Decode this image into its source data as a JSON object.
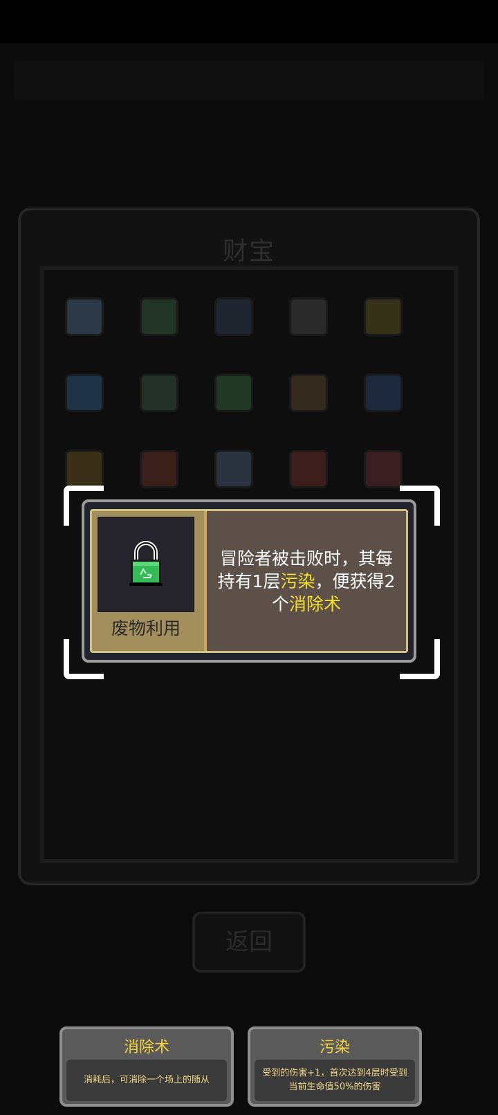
{
  "panel": {
    "title": "财宝"
  },
  "items": [
    {
      "icon": "bag-icon",
      "color": "#2b3846",
      "row": 0,
      "col": 0
    },
    {
      "icon": "leaf-pile-icon",
      "color": "#213426",
      "row": 0,
      "col": 1
    },
    {
      "icon": "shield-icon",
      "color": "#1f2630",
      "row": 0,
      "col": 2
    },
    {
      "icon": "chest-icon",
      "color": "#2a2a2a",
      "row": 0,
      "col": 3
    },
    {
      "icon": "amulet-icon",
      "color": "#36321a",
      "row": 0,
      "col": 4
    },
    {
      "icon": "water-drop-icon",
      "color": "#1f3347",
      "row": 1,
      "col": 0
    },
    {
      "icon": "plant-icon",
      "color": "#223028",
      "row": 1,
      "col": 1
    },
    {
      "icon": "recycle-lock-icon",
      "color": "#223826",
      "row": 1,
      "col": 2
    },
    {
      "icon": "rune-icon",
      "color": "#33291c",
      "row": 1,
      "col": 3
    },
    {
      "icon": "potion-jar-icon",
      "color": "#1d2a3d",
      "row": 1,
      "col": 4
    },
    {
      "icon": "book-icon",
      "color": "#3a2f17",
      "row": 2,
      "col": 0
    },
    {
      "icon": "maple-leaf-icon",
      "color": "#3a1f1a",
      "row": 2,
      "col": 1
    },
    {
      "icon": "armor-icon",
      "color": "#2b3240",
      "row": 2,
      "col": 2
    },
    {
      "icon": "flower-icon",
      "color": "#3e1d1d",
      "row": 2,
      "col": 3
    },
    {
      "icon": "mimic-icon",
      "color": "#3a1f22",
      "row": 2,
      "col": 4
    }
  ],
  "tooltip": {
    "icon": "recycle-lock-icon",
    "name": "废物利用",
    "desc_parts": [
      {
        "text": "冒险者被击败时，其每持有1层",
        "highlight": false
      },
      {
        "text": "污染",
        "highlight": true
      },
      {
        "text": "，便获得2个",
        "highlight": false
      },
      {
        "text": "消除术",
        "highlight": true
      }
    ]
  },
  "back_button": {
    "label": "返回"
  },
  "glossary": [
    {
      "title": "消除术",
      "text": "消耗后，可消除一个场上的随从"
    },
    {
      "title": "污染",
      "text": "受到的伤害+1，首次达到4层时受到当前生命值50%的伤害"
    }
  ],
  "colors": {
    "highlight": "#f4df2e",
    "frame_gold": "#a28f5c",
    "gloss_title": "#f6d33a"
  }
}
